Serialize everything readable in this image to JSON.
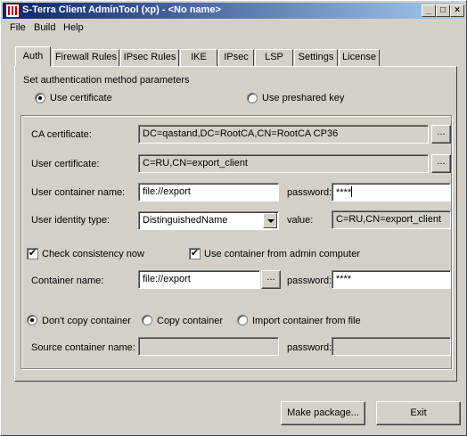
{
  "window": {
    "title": "S-Terra Client AdminTool (xp) - <No name>"
  },
  "titlebar_buttons": {
    "minimize": "_",
    "maximize": "□",
    "close": "×"
  },
  "menu": [
    "File",
    "Build",
    "Help"
  ],
  "tabs": [
    "Auth",
    "Firewall Rules",
    "IPsec Rules",
    "IKE",
    "IPsec",
    "LSP",
    "Settings",
    "License"
  ],
  "active_tab": "Auth",
  "auth": {
    "section_label": "Set authentication method parameters",
    "method_certificate": "Use certificate",
    "method_preshared": "Use preshared key",
    "selected_method": "certificate",
    "ca_certificate": {
      "label": "CA certificate:",
      "value": "DC=qastand,DC=RootCA,CN=RootCA CP36",
      "browse": "..."
    },
    "user_certificate": {
      "label": "User certificate:",
      "value": "C=RU,CN=export_client",
      "browse": "..."
    },
    "user_container": {
      "label": "User container name:",
      "value": "file://export",
      "password_label": "password:",
      "password_value": "****"
    },
    "identity": {
      "label": "User identity type:",
      "value": "DistinguishedName",
      "value_label": "value:",
      "identity_value": "C=RU,CN=export_client"
    },
    "check_consistency": {
      "label": "Check consistency now",
      "checked": true,
      "mark": "✔"
    },
    "use_admin_container": {
      "label": "Use container from admin computer",
      "checked": true,
      "mark": "✔"
    },
    "container": {
      "label": "Container name:",
      "value": "file://export",
      "browse": "...",
      "password_label": "password:",
      "password_value": "****"
    },
    "copy_options": {
      "dont_copy": "Don't copy container",
      "copy": "Copy container",
      "import": "Import container from file",
      "selected": "dont_copy"
    },
    "source_container": {
      "label": "Source container name:",
      "value": "",
      "password_label": "password:",
      "password_value": ""
    }
  },
  "footer": {
    "make_package": "Make package...",
    "exit": "Exit"
  }
}
